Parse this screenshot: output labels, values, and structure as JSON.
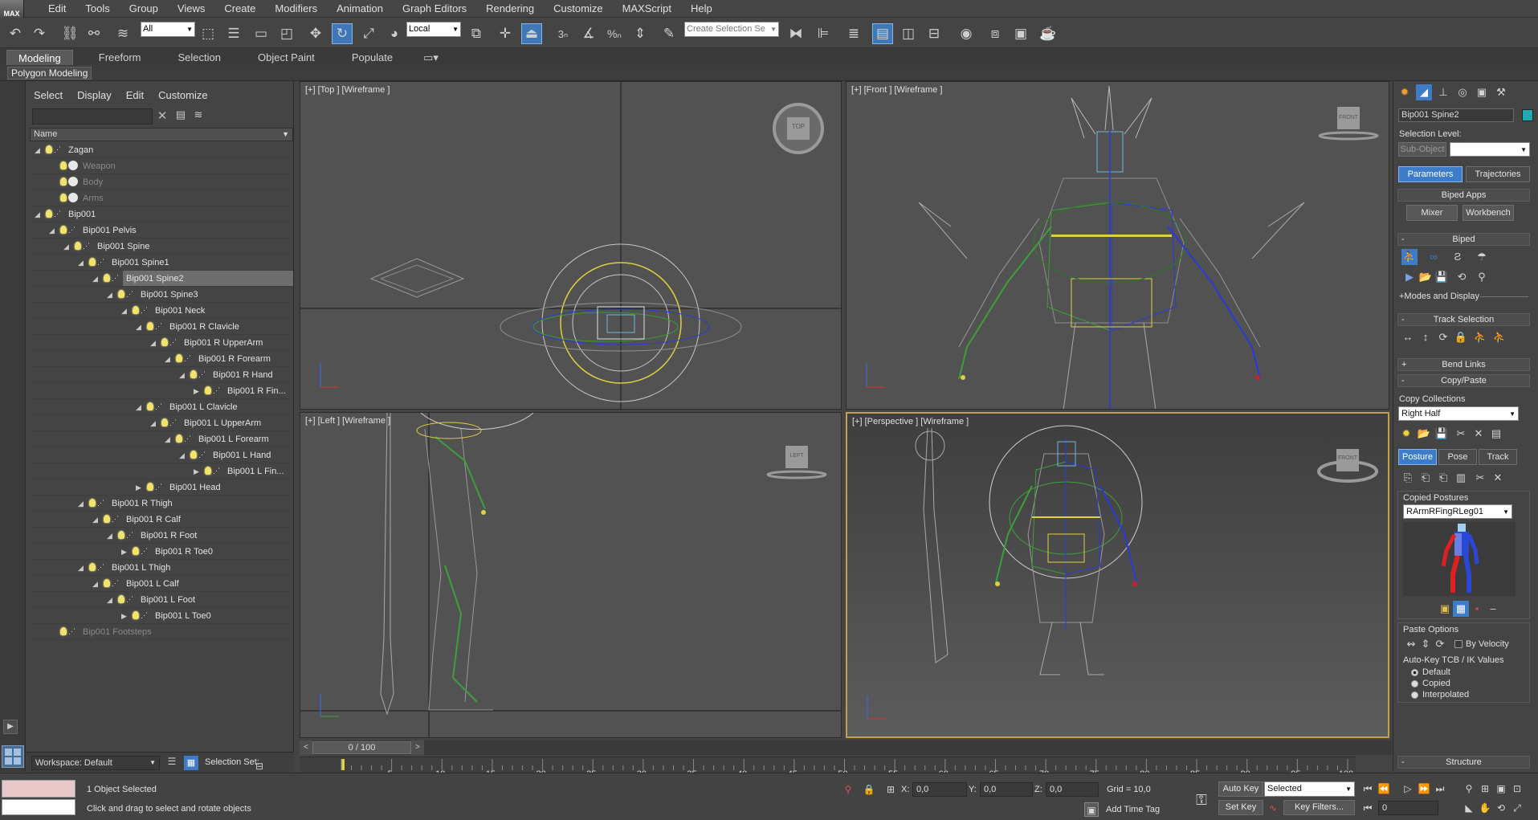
{
  "app": {
    "logo_text": "MAX"
  },
  "menubar": [
    "Edit",
    "Tools",
    "Group",
    "Views",
    "Create",
    "Modifiers",
    "Animation",
    "Graph Editors",
    "Rendering",
    "Customize",
    "MAXScript",
    "Help"
  ],
  "toolbar": {
    "selection_filter": "All",
    "reference_coord": "Local",
    "snap_angle_label": "3",
    "named_selection_placeholder": "Create Selection Se"
  },
  "ribbon": {
    "tabs": [
      "Modeling",
      "Freeform",
      "Selection",
      "Object Paint",
      "Populate"
    ],
    "active_tab": "Modeling",
    "sub_label": "Polygon Modeling"
  },
  "explorer": {
    "menu": [
      "Select",
      "Display",
      "Edit",
      "Customize"
    ],
    "column_header": "Name",
    "rows": [
      {
        "label": "Zagan",
        "depth": 0,
        "arrow": "open",
        "icon": "bulb",
        "dim": false
      },
      {
        "label": "Weapon",
        "depth": 1,
        "arrow": "none",
        "icon": "bulb-sphere",
        "dim": true
      },
      {
        "label": "Body",
        "depth": 1,
        "arrow": "none",
        "icon": "bulb-sphere",
        "dim": true
      },
      {
        "label": "Arms",
        "depth": 1,
        "arrow": "none",
        "icon": "bulb-sphere",
        "dim": true
      },
      {
        "label": "Bip001",
        "depth": 0,
        "arrow": "open",
        "icon": "bulb",
        "dim": false
      },
      {
        "label": "Bip001 Pelvis",
        "depth": 1,
        "arrow": "open",
        "icon": "bulb",
        "dim": false
      },
      {
        "label": "Bip001 Spine",
        "depth": 2,
        "arrow": "open",
        "icon": "bulb",
        "dim": false
      },
      {
        "label": "Bip001 Spine1",
        "depth": 3,
        "arrow": "open",
        "icon": "bulb",
        "dim": false
      },
      {
        "label": "Bip001 Spine2",
        "depth": 4,
        "arrow": "open",
        "icon": "bulb",
        "dim": false,
        "selected": true
      },
      {
        "label": "Bip001 Spine3",
        "depth": 5,
        "arrow": "open",
        "icon": "bulb",
        "dim": false
      },
      {
        "label": "Bip001 Neck",
        "depth": 6,
        "arrow": "open",
        "icon": "bulb",
        "dim": false
      },
      {
        "label": "Bip001 R Clavicle",
        "depth": 7,
        "arrow": "open",
        "icon": "bulb",
        "dim": false
      },
      {
        "label": "Bip001 R UpperArm",
        "depth": 8,
        "arrow": "open",
        "icon": "bulb",
        "dim": false
      },
      {
        "label": "Bip001 R Forearm",
        "depth": 9,
        "arrow": "open",
        "icon": "bulb",
        "dim": false
      },
      {
        "label": "Bip001 R Hand",
        "depth": 10,
        "arrow": "open",
        "icon": "bulb",
        "dim": false
      },
      {
        "label": "Bip001 R Fin...",
        "depth": 11,
        "arrow": "closed",
        "icon": "bulb",
        "dim": false
      },
      {
        "label": "Bip001 L Clavicle",
        "depth": 7,
        "arrow": "open",
        "icon": "bulb",
        "dim": false
      },
      {
        "label": "Bip001 L UpperArm",
        "depth": 8,
        "arrow": "open",
        "icon": "bulb",
        "dim": false
      },
      {
        "label": "Bip001 L Forearm",
        "depth": 9,
        "arrow": "open",
        "icon": "bulb",
        "dim": false
      },
      {
        "label": "Bip001 L Hand",
        "depth": 10,
        "arrow": "open",
        "icon": "bulb",
        "dim": false
      },
      {
        "label": "Bip001 L Fin...",
        "depth": 11,
        "arrow": "closed",
        "icon": "bulb",
        "dim": false
      },
      {
        "label": "Bip001 Head",
        "depth": 7,
        "arrow": "closed",
        "icon": "bulb",
        "dim": false
      },
      {
        "label": "Bip001 R Thigh",
        "depth": 3,
        "arrow": "open",
        "icon": "bulb",
        "dim": false
      },
      {
        "label": "Bip001 R Calf",
        "depth": 4,
        "arrow": "open",
        "icon": "bulb",
        "dim": false
      },
      {
        "label": "Bip001 R Foot",
        "depth": 5,
        "arrow": "open",
        "icon": "bulb",
        "dim": false
      },
      {
        "label": "Bip001 R Toe0",
        "depth": 6,
        "arrow": "closed",
        "icon": "bulb",
        "dim": false
      },
      {
        "label": "Bip001 L Thigh",
        "depth": 3,
        "arrow": "open",
        "icon": "bulb",
        "dim": false
      },
      {
        "label": "Bip001 L Calf",
        "depth": 4,
        "arrow": "open",
        "icon": "bulb",
        "dim": false
      },
      {
        "label": "Bip001 L Foot",
        "depth": 5,
        "arrow": "open",
        "icon": "bulb",
        "dim": false
      },
      {
        "label": "Bip001 L Toe0",
        "depth": 6,
        "arrow": "closed",
        "icon": "bulb",
        "dim": false
      },
      {
        "label": "Bip001 Footsteps",
        "depth": 1,
        "arrow": "none",
        "icon": "bulb",
        "dim": true
      }
    ]
  },
  "workspace": {
    "label": "Workspace: Default",
    "selection_set_label": "Selection Set:"
  },
  "viewports": {
    "top": {
      "label": "[+] [Top ] [Wireframe ]",
      "cube_label": "TOP"
    },
    "front": {
      "label": "[+] [Front ] [Wireframe ]",
      "cube_label": "FRONT"
    },
    "left": {
      "label": "[+] [Left ] [Wireframe ]",
      "cube_label": "LEFT"
    },
    "perspective": {
      "label": "[+] [Perspective ] [Wireframe ]",
      "cube_label": "FRONT"
    }
  },
  "timeline": {
    "frame_readout": "0 / 100",
    "ticks": [
      "5",
      "10",
      "15",
      "20",
      "25",
      "30",
      "35",
      "40",
      "45",
      "50",
      "55",
      "60",
      "65",
      "70",
      "75",
      "80",
      "85",
      "90",
      "95",
      "100"
    ]
  },
  "command_panel": {
    "object_name": "Bip001 Spine2",
    "object_color": "#1fa9b0",
    "selection_level_label": "Selection Level:",
    "sub_object_label": "Sub-Object",
    "tabs": [
      "Parameters",
      "Trajectories"
    ],
    "active_tab": "Parameters",
    "biped_apps_rollout": "Biped Apps",
    "mixer_button": "Mixer",
    "workbench_button": "Workbench",
    "biped_rollout": "Biped",
    "modes_display": "+Modes and Display",
    "track_selection_rollout": "Track Selection",
    "bend_links_rollout": "Bend Links",
    "copy_paste_rollout": "Copy/Paste",
    "copy_collections_label": "Copy Collections",
    "copy_collection_value": "Right Half",
    "cp_tabs": [
      "Posture",
      "Pose",
      "Track"
    ],
    "cp_active_tab": "Posture",
    "copied_postures_label": "Copied Postures",
    "copied_posture_value": "RArmRFingRLeg01",
    "paste_options_label": "Paste Options",
    "by_velocity_label": "By Velocity",
    "autokey_tcb_label": "Auto-Key TCB / IK Values",
    "radio_options": [
      "Default",
      "Copied",
      "Interpolated"
    ],
    "radio_selected": "Default",
    "structure_rollout": "Structure"
  },
  "statusbar": {
    "selection_count": "1 Object Selected",
    "prompt": "Click and drag to select and rotate objects",
    "x_label": "X:",
    "x_value": "0,0",
    "y_label": "Y:",
    "y_value": "0,0",
    "z_label": "Z:",
    "z_value": "0,0",
    "grid_label": "Grid = 10,0",
    "add_time_tag": "Add Time Tag",
    "auto_key": "Auto Key",
    "set_key": "Set Key",
    "key_mode_value": "Selected",
    "key_filters": "Key Filters...",
    "current_frame": "0"
  }
}
